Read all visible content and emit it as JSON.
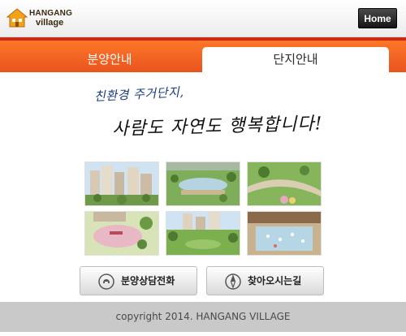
{
  "header": {
    "logo_line1": "HANGANG",
    "logo_line2": "village",
    "home_label": "Home"
  },
  "tabs": [
    {
      "label": "분양안내",
      "active": false
    },
    {
      "label": "단지안내",
      "active": true
    }
  ],
  "tagline": {
    "line1": "친환경 주거단지,",
    "line2": "사람도 자연도 행복합니다!"
  },
  "photos": [
    "apartment-towers-photo",
    "park-plaza-photo",
    "garden-path-photo",
    "playground-photo",
    "lawn-apartments-photo",
    "water-plaza-photo"
  ],
  "buttons": {
    "call_label": "분양상담전화",
    "directions_label": "찾아오시는길"
  },
  "footer": {
    "copyright": "copyright 2014. HANGANG VILLAGE"
  },
  "colors": {
    "accent_orange": "#f2662a",
    "accent_red": "#cc2a15",
    "tagline_blue": "#1c3d7a",
    "footer_gray": "#c9c9c9"
  }
}
